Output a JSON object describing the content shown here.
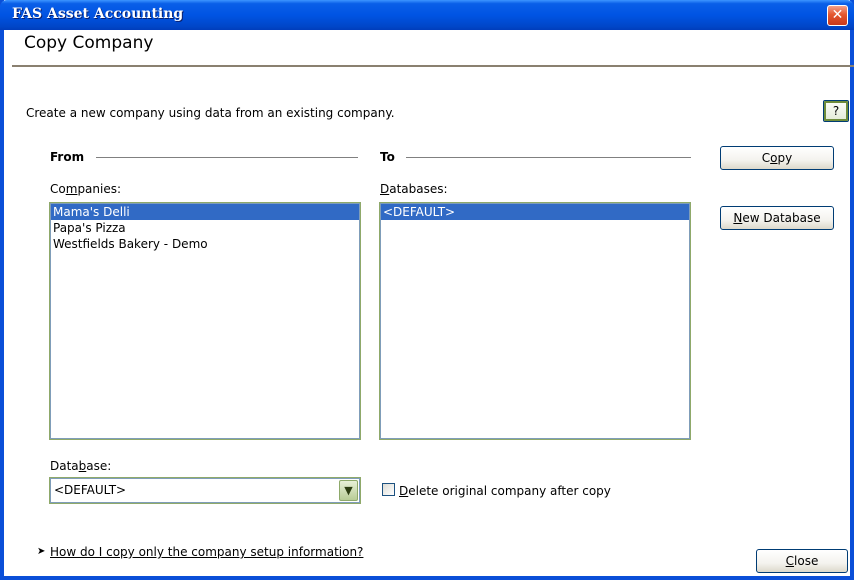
{
  "window": {
    "title": "FAS Asset Accounting",
    "close_glyph": "✕"
  },
  "header": {
    "page_title": "Copy Company",
    "description": "Create a new company using data from an existing company.",
    "help_label": "?"
  },
  "from": {
    "heading": "From",
    "companies_label_pre": "Co",
    "companies_label_u": "m",
    "companies_label_post": "panies:",
    "companies": [
      {
        "label": "Mama's Delli",
        "selected": true
      },
      {
        "label": "Papa's Pizza",
        "selected": false
      },
      {
        "label": "Westfields Bakery - Demo",
        "selected": false
      }
    ],
    "database_label_pre": "Data",
    "database_label_u": "b",
    "database_label_post": "ase:",
    "database_value": "<DEFAULT>"
  },
  "to": {
    "heading": "To",
    "databases_label_u": "D",
    "databases_label_post": "atabases:",
    "databases": [
      {
        "label": "<DEFAULT>",
        "selected": true
      }
    ],
    "delete_checkbox_u": "D",
    "delete_checkbox_post": "elete original company after copy",
    "delete_checked": false
  },
  "buttons": {
    "copy_pre": "C",
    "copy_u": "o",
    "copy_post": "py",
    "new_db_u": "N",
    "new_db_post": "ew Database",
    "close_u": "C",
    "close_post": "lose"
  },
  "footer": {
    "link_arrow": "➤",
    "link_text": "How do I copy only the company setup information?"
  },
  "icons": {
    "combo_arrow": "▼"
  }
}
